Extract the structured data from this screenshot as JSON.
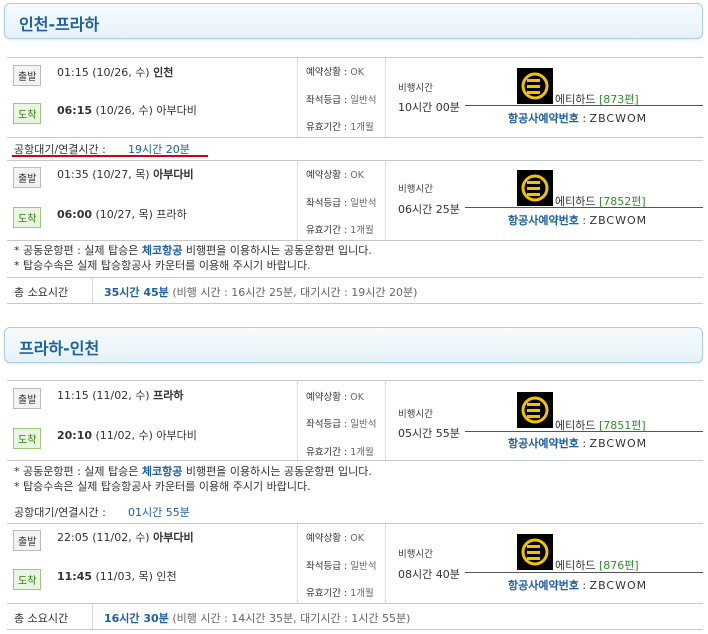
{
  "sections": [
    {
      "title": "인천-프라하",
      "legs": [
        {
          "dep_badge": "출발",
          "dep_time": "01:15",
          "dep_date": "(10/26, 수)",
          "dep_city": "인천",
          "arr_badge": "도착",
          "arr_time": "06:15",
          "arr_date": "(10/26, 수)",
          "arr_city": "아부다비",
          "status_label": "예약상황",
          "status_value": "OK",
          "class_label": "좌석등급",
          "class_value": "일반석",
          "valid_label": "유효기간",
          "valid_value": "1개월",
          "duration_label": "비행시간",
          "duration_value": "10시간 00분",
          "airline": "에티하드",
          "flight": "[873편]",
          "rsv_label": "항공사예약번호",
          "rsv_code": "ZBCWOM"
        },
        {
          "dep_badge": "출발",
          "dep_time": "01:35",
          "dep_date": "(10/27, 목)",
          "dep_city": "아부다비",
          "arr_badge": "도착",
          "arr_time": "06:00",
          "arr_date": "(10/27, 목)",
          "arr_city": "프라하",
          "status_label": "예약상황",
          "status_value": "OK",
          "class_label": "좌석등급",
          "class_value": "일반석",
          "valid_label": "유효기간",
          "valid_value": "1개월",
          "duration_label": "비행시간",
          "duration_value": "06시간 25분",
          "airline": "에티하드",
          "flight": "[7852편]",
          "rsv_label": "항공사예약번호",
          "rsv_code": "ZBCWOM"
        }
      ],
      "connect_label": "공항대기/연결시간 :",
      "connect_value": "19시간 20분",
      "notes": [
        {
          "prefix": "* 공동운항편 : 실제 탑승은 ",
          "bold": "체코항공",
          "suffix": " 비행편을 이용하시는 공동운항편 입니다."
        },
        {
          "prefix": "* 탑승수속은 실제 탑승항공사 카운터를 이용해 주시기 바랍니다.",
          "bold": "",
          "suffix": ""
        }
      ],
      "total_label": "총 소요시간",
      "total_value": "35시간 45분",
      "total_detail": "(비행 시간 : 16시간 25분, 대기시간 : 19시간 20분)"
    },
    {
      "title": "프라하-인천",
      "legs": [
        {
          "dep_badge": "출발",
          "dep_time": "11:15",
          "dep_date": "(11/02, 수)",
          "dep_city": "프라하",
          "arr_badge": "도착",
          "arr_time": "20:10",
          "arr_date": "(11/02, 수)",
          "arr_city": "아부다비",
          "status_label": "예약상황",
          "status_value": "OK",
          "class_label": "좌석등급",
          "class_value": "일반석",
          "valid_label": "유효기간",
          "valid_value": "1개월",
          "duration_label": "비행시간",
          "duration_value": "05시간 55분",
          "airline": "에티하드",
          "flight": "[7851편]",
          "rsv_label": "항공사예약번호",
          "rsv_code": "ZBCWOM"
        },
        {
          "dep_badge": "출발",
          "dep_time": "22:05",
          "dep_date": "(11/02, 수)",
          "dep_city": "아부다비",
          "arr_badge": "도착",
          "arr_time": "11:45",
          "arr_date": "(11/03, 목)",
          "arr_city": "인천",
          "status_label": "예약상황",
          "status_value": "OK",
          "class_label": "좌석등급",
          "class_value": "일반석",
          "valid_label": "유효기간",
          "valid_value": "1개월",
          "duration_label": "비행시간",
          "duration_value": "08시간 40분",
          "airline": "에티하드",
          "flight": "[876편]",
          "rsv_label": "항공사예약번호",
          "rsv_code": "ZBCWOM"
        }
      ],
      "connect_label": "공항대기/연결시간 :",
      "connect_value": "01시간 55분",
      "notes": [
        {
          "prefix": "* 공동운항편 : 실제 탑승은 ",
          "bold": "체코항공",
          "suffix": " 비행편을 이용하시는 공동운항편 입니다."
        },
        {
          "prefix": "* 탑승수속은 실제 탑승항공사 카운터를 이용해 주시기 바랍니다.",
          "bold": "",
          "suffix": ""
        }
      ],
      "total_label": "총 소요시간",
      "total_value": "16시간 30분",
      "total_detail": "(비행 시간 : 14시간 35분, 대기시간 : 1시간 55분)"
    }
  ],
  "icons": {
    "airline_logo": "etihad-logo-icon"
  },
  "colors": {
    "accent": "#1b5fa5",
    "flight_no": "#2e8f2e",
    "underline": "#d0021b"
  }
}
